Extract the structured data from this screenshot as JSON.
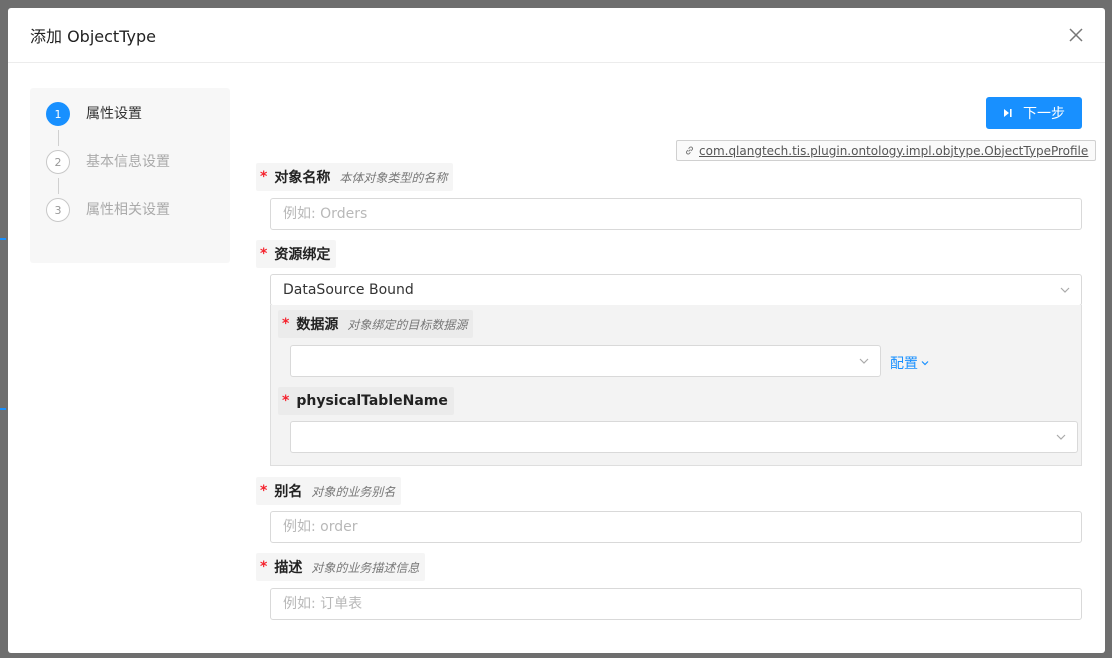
{
  "modal": {
    "title": "添加 ObjectType"
  },
  "steps": [
    {
      "number": "1",
      "label": "属性设置",
      "active": true
    },
    {
      "number": "2",
      "label": "基本信息设置",
      "active": false
    },
    {
      "number": "3",
      "label": "属性相关设置",
      "active": false
    }
  ],
  "toolbar": {
    "next_label": "下一步"
  },
  "plugin": {
    "class_name": "com.qlangtech.tis.plugin.ontology.impl.objtype.ObjectTypeProfile"
  },
  "form": {
    "object_name": {
      "required_mark": "*",
      "label": "对象名称",
      "hint": "本体对象类型的名称",
      "placeholder": "例如: Orders",
      "value": ""
    },
    "resource_binding": {
      "required_mark": "*",
      "label": "资源绑定",
      "selected": "DataSource Bound"
    },
    "datasource": {
      "required_mark": "*",
      "label": "数据源",
      "hint": "对象绑定的目标数据源",
      "selected": "",
      "config_label": "配置"
    },
    "physical_table": {
      "required_mark": "*",
      "label": "physicalTableName",
      "selected": ""
    },
    "alias": {
      "required_mark": "*",
      "label": "别名",
      "hint": "对象的业务别名",
      "placeholder": "例如: order",
      "value": ""
    },
    "description": {
      "required_mark": "*",
      "label": "描述",
      "hint": "对象的业务描述信息",
      "placeholder": "例如: 订单表",
      "value": ""
    }
  },
  "colors": {
    "accent": "#1890ff",
    "required": "#f5222d"
  }
}
